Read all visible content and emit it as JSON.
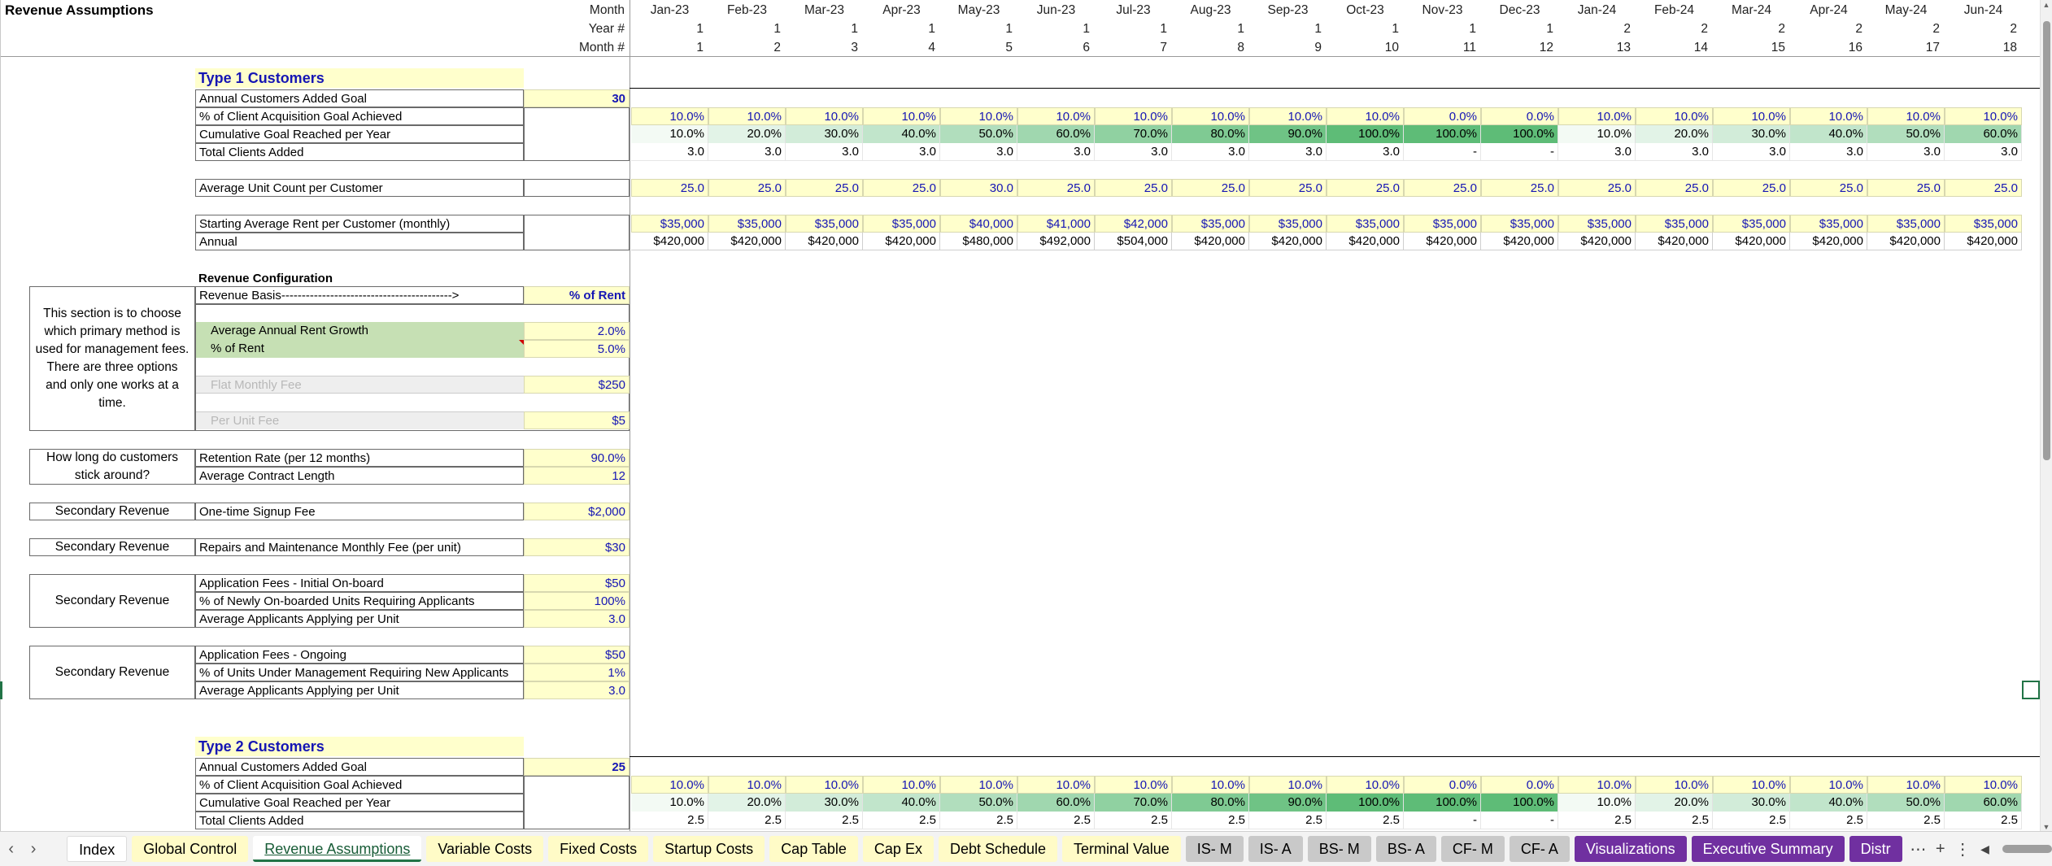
{
  "title": "Revenue Assumptions",
  "row_labels": {
    "month": "Month",
    "year": "Year #",
    "monthnum": "Month #"
  },
  "months": [
    "Jan-23",
    "Feb-23",
    "Mar-23",
    "Apr-23",
    "May-23",
    "Jun-23",
    "Jul-23",
    "Aug-23",
    "Sep-23",
    "Oct-23",
    "Nov-23",
    "Dec-23",
    "Jan-24",
    "Feb-24",
    "Mar-24",
    "Apr-24",
    "May-24",
    "Jun-24"
  ],
  "years": [
    "1",
    "1",
    "1",
    "1",
    "1",
    "1",
    "1",
    "1",
    "1",
    "1",
    "1",
    "1",
    "2",
    "2",
    "2",
    "2",
    "2",
    "2"
  ],
  "month_nums": [
    "1",
    "2",
    "3",
    "4",
    "5",
    "6",
    "7",
    "8",
    "9",
    "10",
    "11",
    "12",
    "13",
    "14",
    "15",
    "16",
    "17",
    "18"
  ],
  "type1": {
    "heading": "Type 1 Customers",
    "goal_label": "Annual Customers Added Goal",
    "goal_value": "30",
    "pct_label": "% of Client Acquisition Goal Achieved",
    "pct": [
      "10.0%",
      "10.0%",
      "10.0%",
      "10.0%",
      "10.0%",
      "10.0%",
      "10.0%",
      "10.0%",
      "10.0%",
      "10.0%",
      "0.0%",
      "0.0%",
      "10.0%",
      "10.0%",
      "10.0%",
      "10.0%",
      "10.0%",
      "10.0%"
    ],
    "cum_label": "Cumulative Goal Reached per Year",
    "cum": [
      "10.0%",
      "20.0%",
      "30.0%",
      "40.0%",
      "50.0%",
      "60.0%",
      "70.0%",
      "80.0%",
      "90.0%",
      "100.0%",
      "100.0%",
      "100.0%",
      "10.0%",
      "20.0%",
      "30.0%",
      "40.0%",
      "50.0%",
      "60.0%"
    ],
    "cum_shade": [
      10,
      20,
      30,
      40,
      50,
      60,
      70,
      80,
      90,
      100,
      100,
      100,
      10,
      20,
      30,
      40,
      50,
      60
    ],
    "clients_label": "Total Clients Added",
    "clients": [
      "3.0",
      "3.0",
      "3.0",
      "3.0",
      "3.0",
      "3.0",
      "3.0",
      "3.0",
      "3.0",
      "3.0",
      "-",
      "-",
      "3.0",
      "3.0",
      "3.0",
      "3.0",
      "3.0",
      "3.0"
    ],
    "units_label": "Average Unit Count per Customer",
    "units": [
      "25.0",
      "25.0",
      "25.0",
      "25.0",
      "30.0",
      "25.0",
      "25.0",
      "25.0",
      "25.0",
      "25.0",
      "25.0",
      "25.0",
      "25.0",
      "25.0",
      "25.0",
      "25.0",
      "25.0",
      "25.0"
    ],
    "rent_label": "Starting Average Rent per Customer (monthly)",
    "rent": [
      "$35,000",
      "$35,000",
      "$35,000",
      "$35,000",
      "$40,000",
      "$41,000",
      "$42,000",
      "$35,000",
      "$35,000",
      "$35,000",
      "$35,000",
      "$35,000",
      "$35,000",
      "$35,000",
      "$35,000",
      "$35,000",
      "$35,000",
      "$35,000"
    ],
    "annual_label": "Annual",
    "annual": [
      "$420,000",
      "$420,000",
      "$420,000",
      "$420,000",
      "$480,000",
      "$492,000",
      "$504,000",
      "$420,000",
      "$420,000",
      "$420,000",
      "$420,000",
      "$420,000",
      "$420,000",
      "$420,000",
      "$420,000",
      "$420,000",
      "$420,000",
      "$420,000"
    ]
  },
  "config": {
    "heading": "Revenue Configuration",
    "basis_label": "Revenue Basis------------------------------------------>",
    "basis_value": "% of Rent",
    "note": "This section is to choose which primary method is used for management fees. There are three options and only one works at a time.",
    "growth_label": "Average Annual Rent Growth",
    "growth_value": "2.0%",
    "pctrent_label": "% of Rent",
    "pctrent_value": "5.0%",
    "flat_label": "Flat Monthly Fee",
    "flat_value": "$250",
    "perunit_label": "Per Unit Fee",
    "perunit_value": "$5",
    "stick_note": "How long do customers stick around?",
    "retention_label": "Retention Rate (per 12 months)",
    "retention_value": "90.0%",
    "contract_label": "Average Contract Length",
    "contract_value": "12",
    "sec1_note": "Secondary Revenue",
    "signup_label": "One-time Signup Fee",
    "signup_value": "$2,000",
    "sec2_note": "Secondary Revenue",
    "repairs_label": "Repairs and Maintenance Monthly Fee (per unit)",
    "repairs_value": "$30",
    "sec3_note": "Secondary Revenue",
    "app1_label": "Application Fees - Initial On-board",
    "app1_value": "$50",
    "app1b_label": "% of Newly On-boarded Units Requiring Applicants",
    "app1b_value": "100%",
    "app1c_label": "Average Applicants Applying per Unit",
    "app1c_value": "3.0",
    "sec4_note": "Secondary Revenue",
    "app2_label": "Application Fees - Ongoing",
    "app2_value": "$50",
    "app2b_label": "% of Units Under Management Requiring New Applicants",
    "app2b_value": "1%",
    "app2c_label": "Average Applicants Applying per Unit",
    "app2c_value": "3.0"
  },
  "type2": {
    "heading": "Type 2 Customers",
    "goal_label": "Annual Customers Added Goal",
    "goal_value": "25",
    "pct_label": "% of Client Acquisition Goal Achieved",
    "pct": [
      "10.0%",
      "10.0%",
      "10.0%",
      "10.0%",
      "10.0%",
      "10.0%",
      "10.0%",
      "10.0%",
      "10.0%",
      "10.0%",
      "0.0%",
      "0.0%",
      "10.0%",
      "10.0%",
      "10.0%",
      "10.0%",
      "10.0%",
      "10.0%"
    ],
    "cum_label": "Cumulative Goal Reached per Year",
    "cum": [
      "10.0%",
      "20.0%",
      "30.0%",
      "40.0%",
      "50.0%",
      "60.0%",
      "70.0%",
      "80.0%",
      "90.0%",
      "100.0%",
      "100.0%",
      "100.0%",
      "10.0%",
      "20.0%",
      "30.0%",
      "40.0%",
      "50.0%",
      "60.0%"
    ],
    "cum_shade": [
      10,
      20,
      30,
      40,
      50,
      60,
      70,
      80,
      90,
      100,
      100,
      100,
      10,
      20,
      30,
      40,
      50,
      60
    ],
    "clients_label": "Total Clients Added",
    "clients": [
      "2.5",
      "2.5",
      "2.5",
      "2.5",
      "2.5",
      "2.5",
      "2.5",
      "2.5",
      "2.5",
      "2.5",
      "-",
      "-",
      "2.5",
      "2.5",
      "2.5",
      "2.5",
      "2.5",
      "2.5"
    ]
  },
  "tabs": [
    {
      "label": "Index",
      "style": "plain"
    },
    {
      "label": "Global Control",
      "style": "yellow"
    },
    {
      "label": "Revenue Assumptions",
      "style": "active"
    },
    {
      "label": "Variable Costs",
      "style": "yellow"
    },
    {
      "label": "Fixed Costs",
      "style": "yellow"
    },
    {
      "label": "Startup Costs",
      "style": "yellow"
    },
    {
      "label": "Cap Table",
      "style": "yellow"
    },
    {
      "label": "Cap Ex",
      "style": "yellow"
    },
    {
      "label": "Debt Schedule",
      "style": "yellow"
    },
    {
      "label": "Terminal Value",
      "style": "yellow"
    },
    {
      "label": "IS- M",
      "style": "gray"
    },
    {
      "label": "IS- A",
      "style": "gray"
    },
    {
      "label": "BS- M",
      "style": "gray"
    },
    {
      "label": "BS- A",
      "style": "gray"
    },
    {
      "label": "CF- M",
      "style": "gray"
    },
    {
      "label": "CF- A",
      "style": "gray"
    },
    {
      "label": "Visualizations",
      "style": "purple"
    },
    {
      "label": "Executive Summary",
      "style": "purple"
    },
    {
      "label": "Distr",
      "style": "purple"
    }
  ],
  "colors": {
    "green_base": "#63be7b",
    "yellow": "#ffffcc",
    "purple": "#7030a0",
    "blue_text": "#1515b4"
  }
}
